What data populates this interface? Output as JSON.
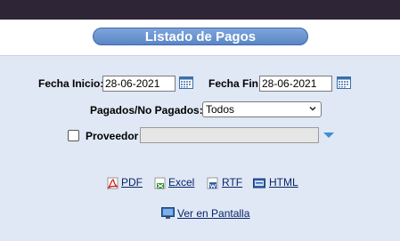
{
  "page": {
    "title": "Listado de Pagos"
  },
  "filters": {
    "fecha_inicio_label": "Fecha Inicio:",
    "fecha_inicio_value": "28-06-2021",
    "fecha_fin_label": "Fecha Fin:",
    "fecha_fin_value": "28-06-2021",
    "pagados_label": "Pagados/No Pagados:",
    "pagados_selected": "Todos",
    "proveedor_label": "Proveedor",
    "proveedor_value": "",
    "proveedor_checked": false
  },
  "exports": {
    "pdf_label": "PDF",
    "excel_label": "Excel",
    "rtf_label": "RTF",
    "html_label": "HTML",
    "screen_label": "Ver en Pantalla"
  },
  "colors": {
    "accent": "#5b86c6",
    "background": "#dfe8f4",
    "topbar": "#2e2636"
  }
}
